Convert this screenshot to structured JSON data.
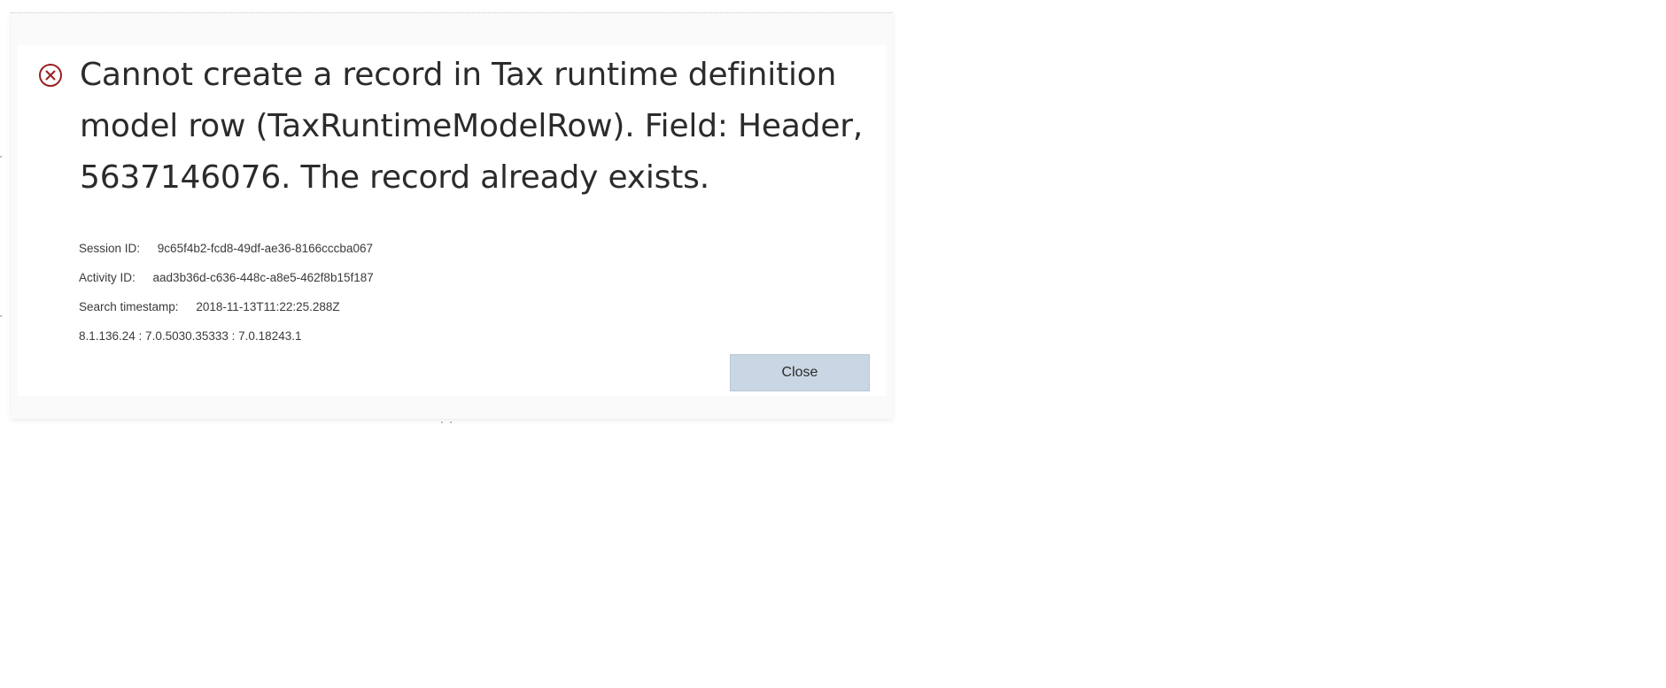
{
  "dialog": {
    "message_lines": [
      "Cannot create a record in Tax runtime definition",
      "model row (TaxRuntimeModelRow). Field: Header,",
      "5637146076. The record already exists."
    ],
    "details": [
      {
        "label": "Session ID:",
        "value": "9c65f4b2-fcd8-49df-ae36-8166cccba067"
      },
      {
        "label": "Activity ID:",
        "value": "aad3b36d-c636-448c-a8e5-462f8b15f187"
      },
      {
        "label": "Search timestamp:",
        "value": "2018-11-13T11:22:25.288Z"
      }
    ],
    "version": "8.1.136.24 : 7.0.5030.35333 : 7.0.18243.1",
    "close_label": "Close",
    "icon": "error-circle-x-icon",
    "colors": {
      "error_icon": "#9b2020",
      "close_button_bg": "#c9d6e3",
      "text": "#2b2b2b"
    }
  }
}
